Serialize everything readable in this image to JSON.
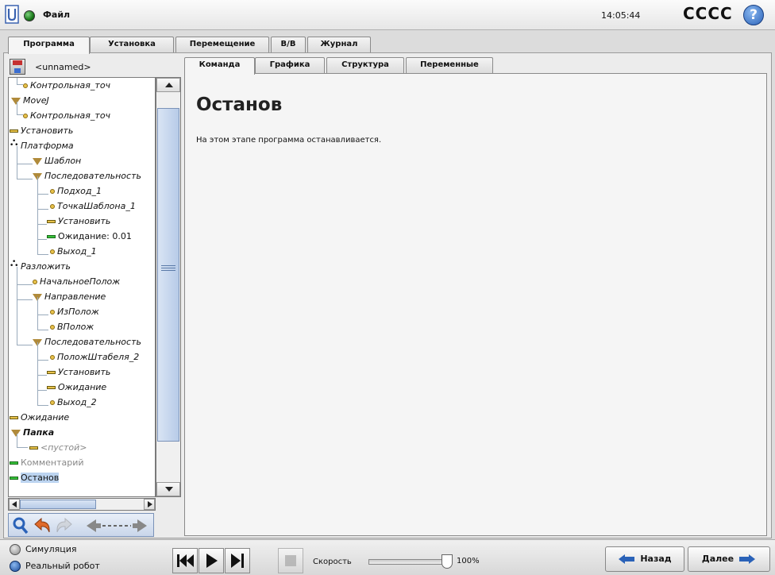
{
  "header": {
    "file_menu": "Файл",
    "time": "14:05:44",
    "robot_name": "CCCC",
    "help": "?"
  },
  "main_tabs": [
    {
      "label": "Программа",
      "active": true
    },
    {
      "label": "Установка",
      "active": false
    },
    {
      "label": "Перемещение",
      "active": false
    },
    {
      "label": "В/В",
      "active": false
    },
    {
      "label": "Журнал",
      "active": false
    }
  ],
  "program": {
    "name": "<unnamed>"
  },
  "tree": [
    {
      "label": "Контрольная_точ",
      "icon": "waypoint-icon",
      "indent": 1
    },
    {
      "label": "MoveJ",
      "icon": "move-icon",
      "indent": 0
    },
    {
      "label": "Контрольная_точ",
      "icon": "waypoint-icon",
      "indent": 1
    },
    {
      "label": "Установить",
      "icon": "set-icon",
      "indent": 0
    },
    {
      "label": "Платформа",
      "icon": "pallet-icon",
      "indent": 0
    },
    {
      "label": "Шаблон",
      "icon": "pattern-icon",
      "indent": 1
    },
    {
      "label": "Последовательность",
      "icon": "sequence-icon",
      "indent": 1
    },
    {
      "label": "Подход_1",
      "icon": "waypoint-icon",
      "indent": 2
    },
    {
      "label": "ТочкаШаблона_1",
      "icon": "waypoint-icon",
      "indent": 2
    },
    {
      "label": "Установить",
      "icon": "set-icon",
      "indent": 2
    },
    {
      "label": "Ожидание: 0.01",
      "icon": "wait-icon",
      "indent": 2
    },
    {
      "label": "Выход_1",
      "icon": "waypoint-icon",
      "indent": 2
    },
    {
      "label": "Разложить",
      "icon": "pallet-icon",
      "indent": 0
    },
    {
      "label": "НачальноеПолож",
      "icon": "waypoint-icon",
      "indent": 1
    },
    {
      "label": "Направление",
      "icon": "direction-icon",
      "indent": 1
    },
    {
      "label": "ИзПолож",
      "icon": "waypoint-icon",
      "indent": 2
    },
    {
      "label": "ВПолож",
      "icon": "waypoint-icon",
      "indent": 2
    },
    {
      "label": "Последовательность",
      "icon": "sequence-icon",
      "indent": 1
    },
    {
      "label": "ПоложШтабеля_2",
      "icon": "waypoint-icon",
      "indent": 2
    },
    {
      "label": "Установить",
      "icon": "set-icon",
      "indent": 2
    },
    {
      "label": "Ожидание",
      "icon": "wait-icon",
      "indent": 2
    },
    {
      "label": "Выход_2",
      "icon": "waypoint-icon",
      "indent": 2
    },
    {
      "label": "Ожидание",
      "icon": "wait-icon",
      "indent": 0
    },
    {
      "label": "Папка",
      "icon": "folder-icon",
      "indent": 0
    },
    {
      "label": "<пустой>",
      "icon": "empty-icon",
      "indent": 1
    },
    {
      "label": "Комментарий",
      "icon": "comment-icon",
      "indent": 0
    },
    {
      "label": "Останов",
      "icon": "halt-icon",
      "indent": 0
    }
  ],
  "sub_tabs": [
    {
      "label": "Команда",
      "active": true
    },
    {
      "label": "Графика",
      "active": false
    },
    {
      "label": "Структура",
      "active": false
    },
    {
      "label": "Переменные",
      "active": false
    }
  ],
  "command": {
    "title": "Останов",
    "description": "На этом этапе программа останавливается."
  },
  "bottom": {
    "sim_label": "Симуляция",
    "real_label": "Реальный робот",
    "speed_label": "Скорость",
    "speed_value": "100%",
    "speed_fraction": 1.0,
    "back_label": "Назад",
    "next_label": "Далее"
  },
  "colors": {
    "accent_blue": "#2a62b8",
    "selection": "#bcd4f0",
    "node_yellow": "#e8c24a",
    "node_green": "#37c23a"
  }
}
